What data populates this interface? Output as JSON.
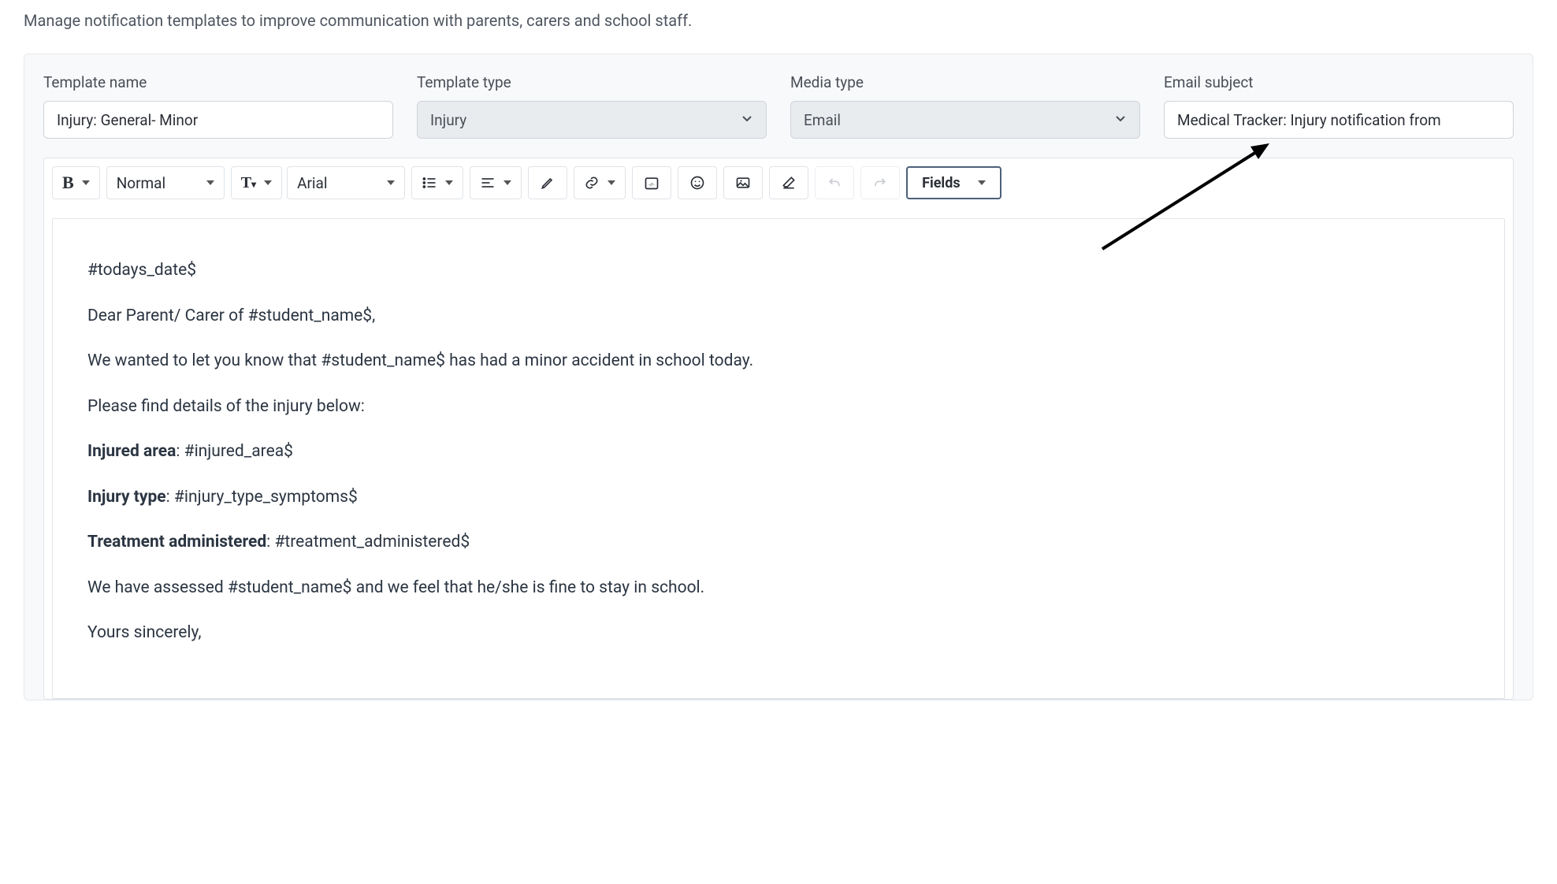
{
  "page": {
    "description": "Manage notification templates to improve communication with parents, carers and school staff."
  },
  "fields": {
    "template_name": {
      "label": "Template name",
      "value": "Injury: General- Minor"
    },
    "template_type": {
      "label": "Template type",
      "value": "Injury"
    },
    "media_type": {
      "label": "Media type",
      "value": "Email"
    },
    "email_subject": {
      "label": "Email subject",
      "value": "Medical Tracker: Injury notification from"
    }
  },
  "toolbar": {
    "paragraph_format": "Normal",
    "font_family": "Arial",
    "fields_button": "Fields"
  },
  "body": {
    "p1": "#todays_date$",
    "p2": "Dear Parent/ Carer of #student_name$,",
    "p3": "We wanted to let you know that #student_name$ has had a minor accident in school today.",
    "p4": "Please find details of the injury below:",
    "p5a": "Injured area",
    "p5b": ": #injured_area$",
    "p6a": "Injury type",
    "p6b": ": #injury_type_symptoms$",
    "p7a": "Treatment administered",
    "p7b": ": #treatment_administered$",
    "p8": "We have assessed #student_name$ and we feel that he/she is fine to stay in school.",
    "p9": "Yours sincerely,"
  }
}
